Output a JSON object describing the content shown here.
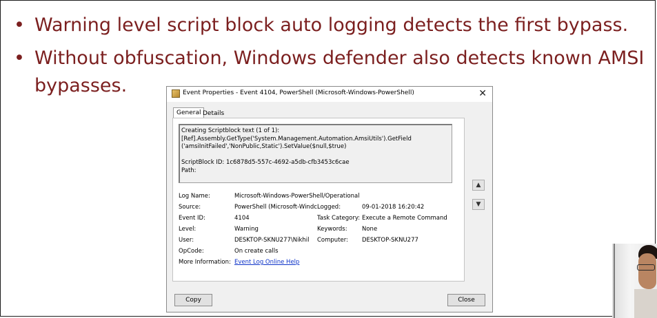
{
  "slide": {
    "bullet_glyph": "•",
    "bullet1": "Warning level script block auto logging detects the first bypass.",
    "bullet2_line1": " Without obfuscation, Windows defender also detects known AMSI",
    "bullet2_line2": "bypasses.",
    "text_color": "#7b1f1f"
  },
  "dialog": {
    "title": "Event Properties - Event 4104, PowerShell (Microsoft-Windows-PowerShell)",
    "close_glyph": "✕",
    "tabs": [
      "General",
      "Details"
    ],
    "script_text": "Creating Scriptblock text (1 of 1):\n[Ref].Assembly.GetType('System.Management.Automation.AmsiUtils').GetField\n('amsiInitFailed','NonPublic,Static').SetValue($null,$true)\n\nScriptBlock ID: 1c6878d5-557c-4692-a5db-cfb3453c6cae\nPath:",
    "fields": {
      "log_name_label": "Log Name:",
      "log_name_value": "Microsoft-Windows-PowerShell/Operational",
      "source_label": "Source:",
      "source_value": "PowerShell (Microsoft-Windc",
      "logged_label": "Logged:",
      "logged_value": "09-01-2018 16:20:42",
      "event_id_label": "Event ID:",
      "event_id_value": "4104",
      "task_category_label": "Task Category:",
      "task_category_value": "Execute a Remote Command",
      "level_label": "Level:",
      "level_value": "Warning",
      "keywords_label": "Keywords:",
      "keywords_value": "None",
      "user_label": "User:",
      "user_value": "DESKTOP-SKNU277\\Nikhil",
      "computer_label": "Computer:",
      "computer_value": "DESKTOP-SKNU277",
      "opcode_label": "OpCode:",
      "opcode_value": "On create calls",
      "more_info_label": "More Information:",
      "more_info_link": "Event Log Online Help"
    },
    "scroll_up_glyph": "▲",
    "scroll_down_glyph": "▼",
    "copy_label": "Copy",
    "close_label": "Close"
  }
}
